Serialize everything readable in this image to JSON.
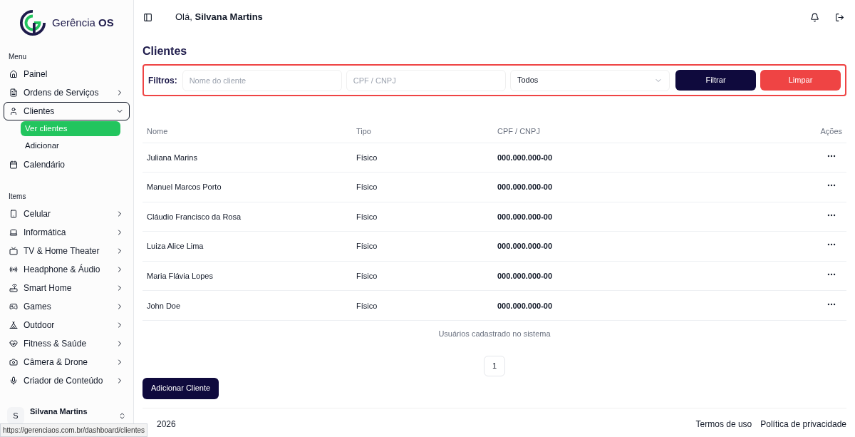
{
  "brand": {
    "name": "Gerência",
    "suffix": "OS"
  },
  "sidebar": {
    "sections": [
      {
        "title": "Menu",
        "items": [
          {
            "label": "Painel",
            "expandable": false,
            "selected": false
          },
          {
            "label": "Ordens de Serviços",
            "expandable": true,
            "expanded": false,
            "selected": false
          },
          {
            "label": "Clientes",
            "expandable": true,
            "expanded": true,
            "selected": true,
            "children": [
              {
                "label": "Ver clientes",
                "selected": true
              },
              {
                "label": "Adicionar",
                "selected": false
              }
            ]
          },
          {
            "label": "Calendário",
            "expandable": false,
            "selected": false
          }
        ]
      },
      {
        "title": "Items",
        "items": [
          {
            "label": "Celular",
            "expandable": true,
            "expanded": false,
            "selected": false
          },
          {
            "label": "Informática",
            "expandable": true,
            "expanded": false,
            "selected": false
          },
          {
            "label": "TV & Home Theater",
            "expandable": true,
            "expanded": false,
            "selected": false
          },
          {
            "label": "Headphone & Áudio",
            "expandable": true,
            "expanded": false,
            "selected": false
          },
          {
            "label": "Smart Home",
            "expandable": true,
            "expanded": false,
            "selected": false
          },
          {
            "label": "Games",
            "expandable": true,
            "expanded": false,
            "selected": false
          },
          {
            "label": "Outdoor",
            "expandable": true,
            "expanded": false,
            "selected": false
          },
          {
            "label": "Fitness & Saúde",
            "expandable": true,
            "expanded": false,
            "selected": false
          },
          {
            "label": "Câmera & Drone",
            "expandable": true,
            "expanded": false,
            "selected": false
          },
          {
            "label": "Criador de Conteúdo",
            "expandable": true,
            "expanded": false,
            "selected": false
          }
        ]
      }
    ],
    "user": {
      "initial": "S",
      "name": "Silvana Martins"
    }
  },
  "header": {
    "greeting": "Olá,",
    "name": "Silvana Martins"
  },
  "page_title": "Clientes",
  "filters": {
    "label": "Filtros:",
    "name_placeholder": "Nome do cliente",
    "doc_placeholder": "CPF / CNPJ",
    "type_value": "Todos",
    "filter_button": "Filtrar",
    "clear_button": "Limpar"
  },
  "table": {
    "columns": [
      "Nome",
      "Tipo",
      "CPF / CNPJ",
      "Ações"
    ],
    "rows": [
      {
        "name": "Juliana Marins",
        "type": "Físico",
        "doc": "000.000.000-00"
      },
      {
        "name": "Manuel Marcos Porto",
        "type": "Físico",
        "doc": "000.000.000-00"
      },
      {
        "name": "Cláudio Francisco da Rosa",
        "type": "Físico",
        "doc": "000.000.000-00"
      },
      {
        "name": "Luiza Alice Lima",
        "type": "Físico",
        "doc": "000.000.000-00"
      },
      {
        "name": "Maria Flávia Lopes",
        "type": "Físico",
        "doc": "000.000.000-00"
      },
      {
        "name": "John Doe",
        "type": "Físico",
        "doc": "000.000.000-00"
      }
    ],
    "caption": "Usuários cadastrado no sistema"
  },
  "pagination": [
    {
      "label": "1",
      "selected": true
    }
  ],
  "add_button": "Adicionar Cliente",
  "footer": {
    "copyright": "2026",
    "links": [
      "Termos de uso",
      "Política de privacidade"
    ]
  },
  "status_url": "https://gerenciaos.com.br/dashboard/clientes"
}
